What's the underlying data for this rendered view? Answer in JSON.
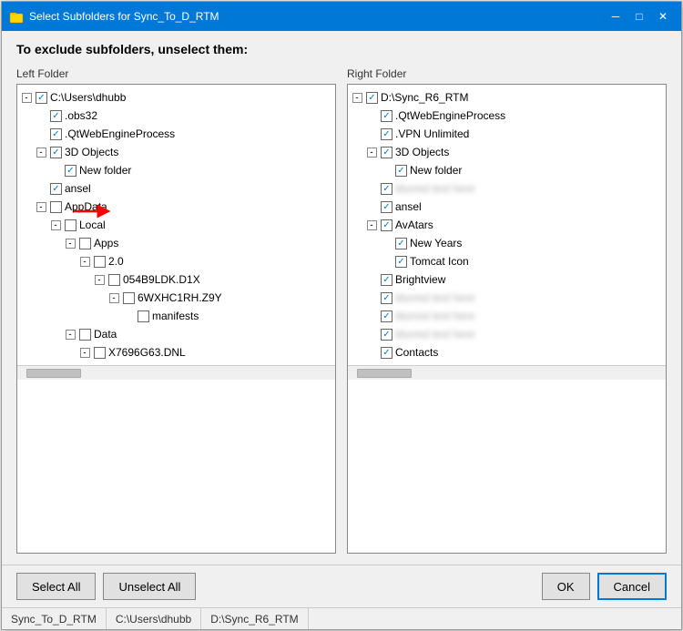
{
  "window": {
    "title": "Select Subfolders for Sync_To_D_RTM",
    "icon": "folder"
  },
  "instruction": "To exclude subfolders, unselect them:",
  "left_panel": {
    "label": "Left Folder",
    "items": [
      {
        "id": "lf1",
        "depth": 0,
        "expand": "-",
        "checked": true,
        "label": "C:\\Users\\dhubb",
        "blurred": false
      },
      {
        "id": "lf2",
        "depth": 1,
        "expand": "",
        "checked": true,
        "label": ".obs32",
        "blurred": false
      },
      {
        "id": "lf3",
        "depth": 1,
        "expand": "",
        "checked": true,
        "label": ".QtWebEngineProcess",
        "blurred": false
      },
      {
        "id": "lf4",
        "depth": 1,
        "expand": "-",
        "checked": true,
        "label": "3D Objects",
        "blurred": false
      },
      {
        "id": "lf5",
        "depth": 2,
        "expand": "",
        "checked": true,
        "label": "New folder",
        "blurred": false
      },
      {
        "id": "lf6",
        "depth": 1,
        "expand": "",
        "checked": true,
        "label": "ansel",
        "blurred": false
      },
      {
        "id": "lf7",
        "depth": 1,
        "expand": "-",
        "checked": false,
        "label": "AppData",
        "blurred": false
      },
      {
        "id": "lf8",
        "depth": 2,
        "expand": "-",
        "checked": false,
        "label": "Local",
        "blurred": false
      },
      {
        "id": "lf9",
        "depth": 3,
        "expand": "-",
        "checked": false,
        "label": "Apps",
        "blurred": false
      },
      {
        "id": "lf10",
        "depth": 4,
        "expand": "-",
        "checked": false,
        "label": "2.0",
        "blurred": false
      },
      {
        "id": "lf11",
        "depth": 5,
        "expand": "-",
        "checked": false,
        "label": "054B9LDK.D1X",
        "blurred": false
      },
      {
        "id": "lf12",
        "depth": 6,
        "expand": "-",
        "checked": false,
        "label": "6WXHC1RH.Z9Y",
        "blurred": false
      },
      {
        "id": "lf13",
        "depth": 7,
        "expand": "",
        "checked": false,
        "label": "manifests",
        "blurred": false
      },
      {
        "id": "lf14",
        "depth": 3,
        "expand": "-",
        "checked": false,
        "label": "Data",
        "blurred": false
      },
      {
        "id": "lf15",
        "depth": 4,
        "expand": "-",
        "checked": false,
        "label": "X7696G63.DNL",
        "blurred": false
      }
    ]
  },
  "right_panel": {
    "label": "Right Folder",
    "items": [
      {
        "id": "rf1",
        "depth": 0,
        "expand": "-",
        "checked": true,
        "label": "D:\\Sync_R6_RTM",
        "blurred": false
      },
      {
        "id": "rf2",
        "depth": 1,
        "expand": "",
        "checked": true,
        "label": ".QtWebEngineProcess",
        "blurred": false
      },
      {
        "id": "rf3",
        "depth": 1,
        "expand": "",
        "checked": true,
        "label": ".VPN Unlimited",
        "blurred": false
      },
      {
        "id": "rf4",
        "depth": 1,
        "expand": "-",
        "checked": true,
        "label": "3D Objects",
        "blurred": false
      },
      {
        "id": "rf5",
        "depth": 2,
        "expand": "",
        "checked": true,
        "label": "New folder",
        "blurred": false
      },
      {
        "id": "rf6",
        "depth": 1,
        "expand": "",
        "checked": true,
        "label": "",
        "blurred": true
      },
      {
        "id": "rf7",
        "depth": 1,
        "expand": "",
        "checked": true,
        "label": "ansel",
        "blurred": false
      },
      {
        "id": "rf8",
        "depth": 1,
        "expand": "-",
        "checked": true,
        "label": "AvAtars",
        "blurred": false
      },
      {
        "id": "rf9",
        "depth": 2,
        "expand": "",
        "checked": true,
        "label": "New Years",
        "blurred": false
      },
      {
        "id": "rf10",
        "depth": 2,
        "expand": "",
        "checked": true,
        "label": "Tomcat Icon",
        "blurred": false
      },
      {
        "id": "rf11",
        "depth": 1,
        "expand": "",
        "checked": true,
        "label": "Brightview",
        "blurred": false
      },
      {
        "id": "rf12",
        "depth": 1,
        "expand": "",
        "checked": true,
        "label": "",
        "blurred": true
      },
      {
        "id": "rf13",
        "depth": 1,
        "expand": "",
        "checked": true,
        "label": "",
        "blurred": true
      },
      {
        "id": "rf14",
        "depth": 1,
        "expand": "",
        "checked": true,
        "label": "",
        "blurred": true
      },
      {
        "id": "rf15",
        "depth": 1,
        "expand": "",
        "checked": true,
        "label": "Contacts",
        "blurred": false
      }
    ]
  },
  "buttons": {
    "select_all": "Select All",
    "unselect_all": "Unselect All",
    "ok": "OK",
    "cancel": "Cancel"
  },
  "status_bar": {
    "item1": "Sync_To_D_RTM",
    "item2": "C:\\Users\\dhubb",
    "item3": "D:\\Sync_R6_RTM"
  }
}
